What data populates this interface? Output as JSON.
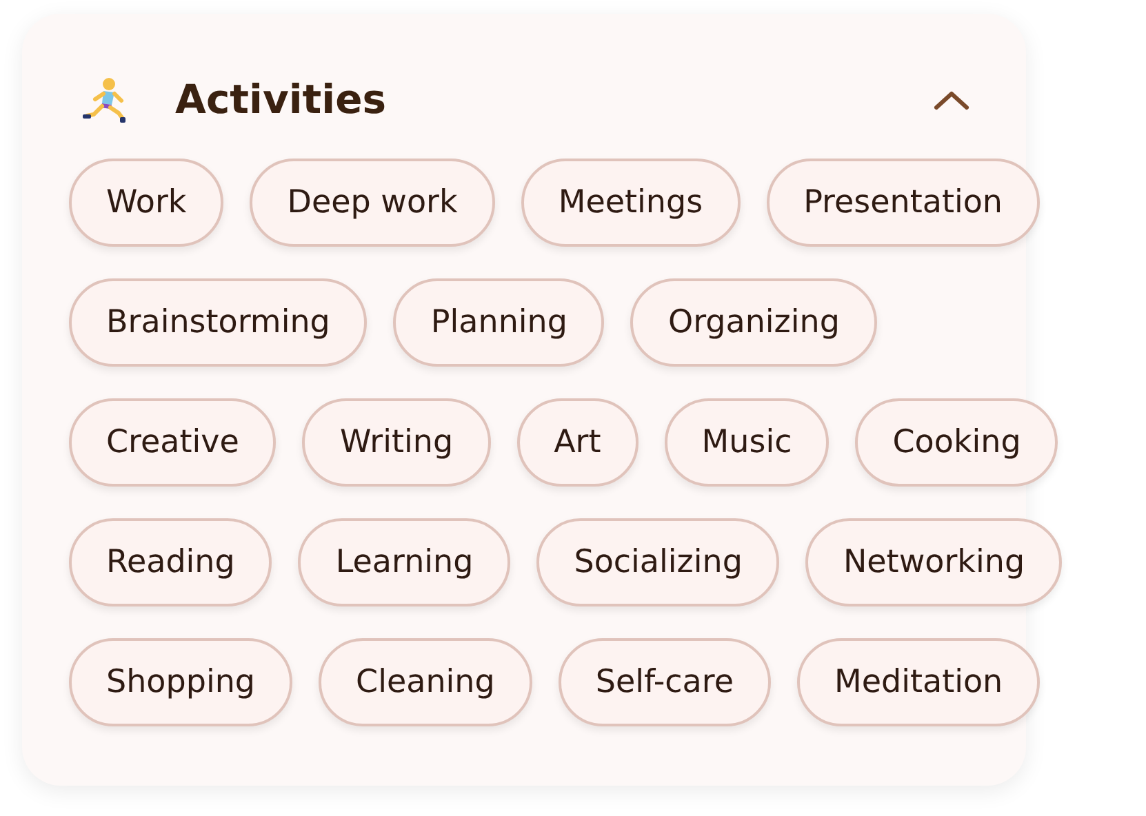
{
  "panel": {
    "title": "Activities",
    "expanded": true,
    "rows": [
      [
        "Work",
        "Deep work",
        "Meetings",
        "Presentation"
      ],
      [
        "Brainstorming",
        "Planning",
        "Organizing"
      ],
      [
        "Creative",
        "Writing",
        "Art",
        "Music",
        "Cooking"
      ],
      [
        "Reading",
        "Learning",
        "Socializing",
        "Networking"
      ],
      [
        "Shopping",
        "Cleaning",
        "Self-care",
        "Meditation"
      ]
    ]
  }
}
